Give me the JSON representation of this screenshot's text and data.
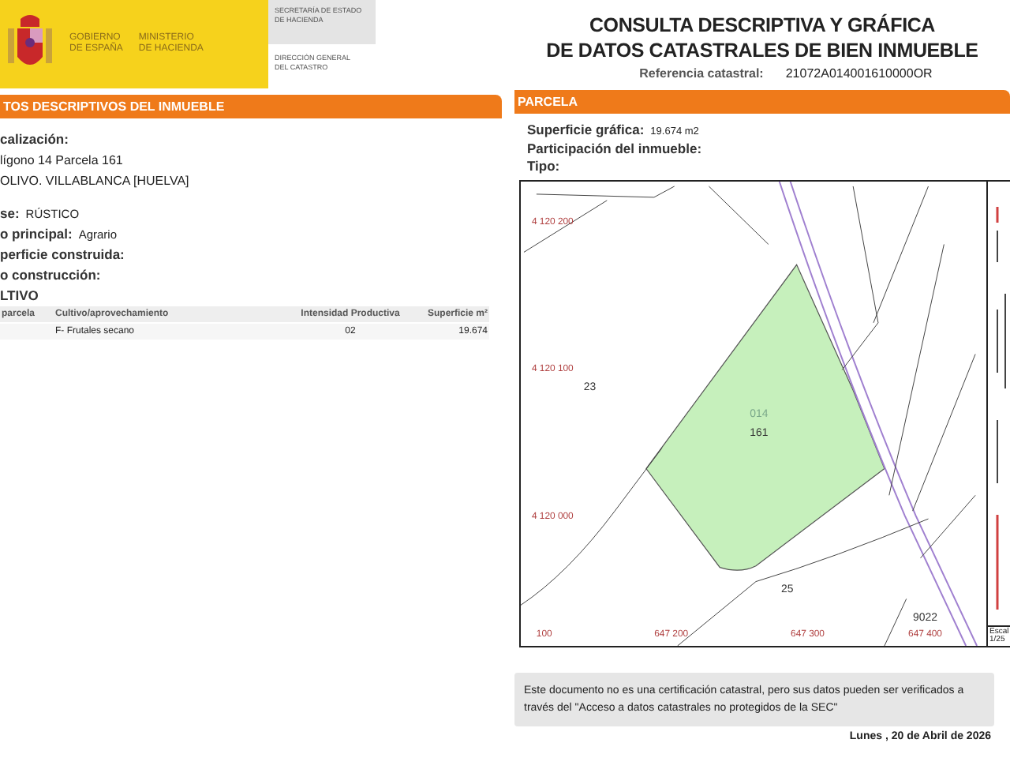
{
  "header": {
    "gov_lines": [
      "GOBIERNO",
      "DE ESPAÑA"
    ],
    "ministry_lines": [
      "MINISTERIO",
      "DE HACIENDA"
    ],
    "secretary_lines": [
      "SECRETARÍA DE ESTADO",
      "DE HACIENDA"
    ],
    "direction_lines": [
      "DIRECCIÓN GENERAL",
      "DEL CATASTRO"
    ],
    "title_lines": [
      "CONSULTA DESCRIPTIVA Y GRÁFICA",
      "DE DATOS CATASTRALES DE BIEN INMUEBLE"
    ],
    "reference": {
      "label": "Referencia catastral:",
      "value": "21072A014001610000OR"
    }
  },
  "property_section": {
    "title": "TOS DESCRIPTIVOS DEL INMUEBLE",
    "location": {
      "label": "calización:",
      "lines": [
        "lígono 14 Parcela 161",
        "OLIVO. VILLABLANCA [HUELVA]"
      ]
    },
    "fields": [
      {
        "label": "se:",
        "value": "RÚSTICO"
      },
      {
        "label": "o principal:",
        "value": "Agrario"
      },
      {
        "label": "perficie construida:"
      },
      {
        "label": "o construcción:"
      }
    ],
    "cultivo": {
      "title": "LTIVO",
      "columns": [
        "parcela",
        "Cultivo/aprovechamiento",
        "Intensidad Productiva",
        "Superficie m²"
      ],
      "rows": [
        [
          "",
          "F- Frutales secano",
          "02",
          "19.674"
        ]
      ]
    }
  },
  "parcel_section": {
    "title": "PARCELA",
    "fields": [
      {
        "label": "Superficie gráfica:",
        "value": "19.674 m2"
      },
      {
        "label": "Participación del inmueble:"
      },
      {
        "label": "Tipo:"
      }
    ],
    "map": {
      "coordinate_labels": [
        "4 120 200",
        "4 120 100",
        "4 120 000",
        "100",
        "647 200",
        "647 300",
        "647 400"
      ],
      "parcel_labels": [
        {
          "text": "014",
          "kind": "polygon"
        },
        {
          "text": "161",
          "kind": "parcel"
        },
        {
          "text": "23",
          "kind": "parcel"
        },
        {
          "text": "25",
          "kind": "parcel"
        },
        {
          "text": "9022",
          "kind": "parcel"
        }
      ],
      "scale_lines": [
        "Escal",
        "1/25"
      ]
    }
  },
  "note": "Este documento no es una certificación catastral, pero sus datos pueden ser verificados a través del \"Acceso a datos catastrales no protegidos de la SEC\"",
  "date": "Lunes , 20 de Abril de 2026"
}
